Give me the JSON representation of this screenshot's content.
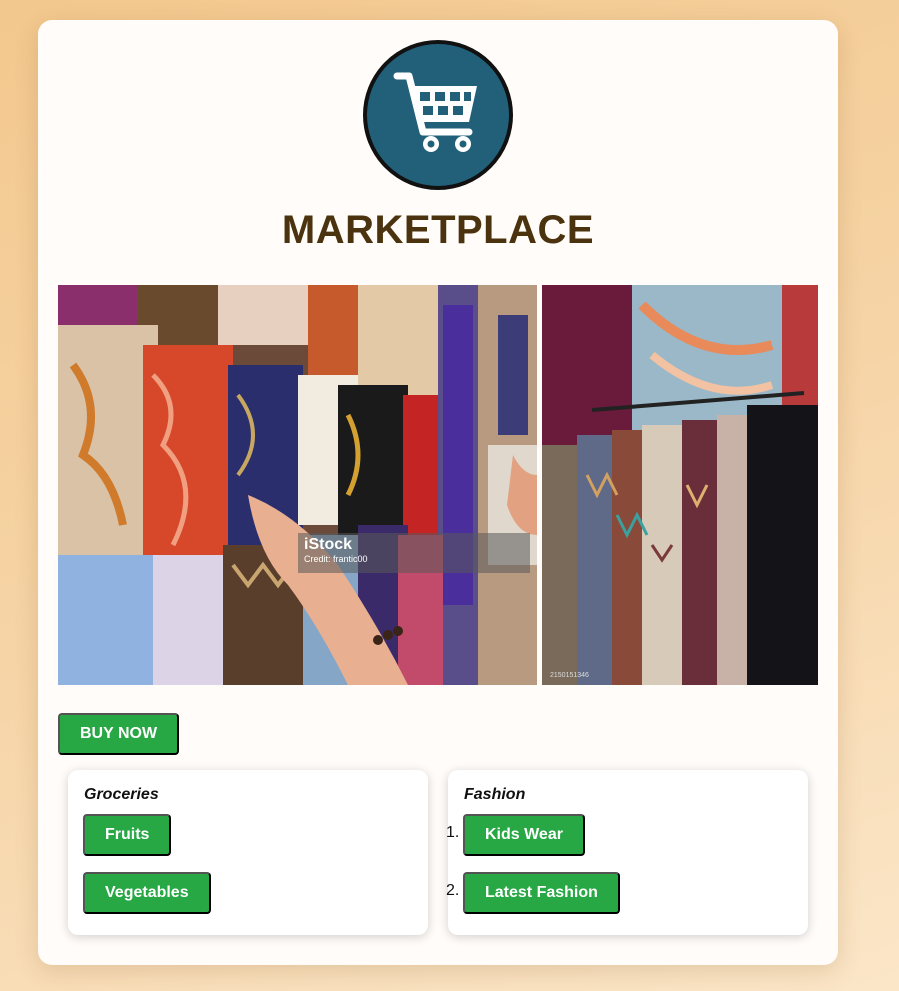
{
  "header": {
    "logo_icon": "shopping-cart-icon",
    "title": "MARKETPLACE"
  },
  "gallery": {
    "watermark_logo": "iStock",
    "watermark_credit": "Credit: frantic00",
    "stock_id": "2150151346"
  },
  "actions": {
    "buy_label": "BUY NOW"
  },
  "categories": [
    {
      "title": "Groceries",
      "items": [
        "Fruits",
        "Vegetables"
      ]
    },
    {
      "title": "Fashion",
      "items": [
        "Kids Wear",
        "Latest Fashion"
      ],
      "markers": [
        "1.",
        "2."
      ]
    }
  ],
  "colors": {
    "button": "#28a745",
    "logo_bg": "#22607a",
    "title": "#4a330e"
  }
}
